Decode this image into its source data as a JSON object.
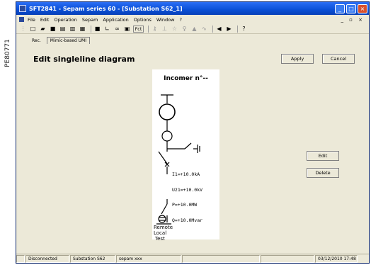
{
  "side_code": "PE80771",
  "window": {
    "title": "SFT2841 - Sepam series 60 - [Substation S62_1]",
    "controls": [
      "minimize-icon",
      "maximize-icon",
      "close-icon"
    ]
  },
  "menu": {
    "items": [
      "File",
      "Edit",
      "Operation",
      "Sepam",
      "Application",
      "Options",
      "Window",
      "?"
    ],
    "mdi_controls": "_ ▫ ×"
  },
  "toolbar": {
    "fct_label": "Fct",
    "icons": [
      "new-icon",
      "open-icon",
      "save-icon",
      "print-icon",
      "print-preview-icon",
      "print-all-icon",
      "sepam-save-icon",
      "chart-icon",
      "network-icon",
      "panel-icon",
      "fct-icon",
      "key-icon",
      "probe-icon",
      "connect-icon",
      "disconnect-icon",
      "alarm-icon",
      "wave-icon",
      "arrow-left-icon",
      "arrow-right-icon",
      "help-icon"
    ]
  },
  "tabs": [
    {
      "label": "Rec.",
      "active": false
    },
    {
      "label": "Mimic-based UMI",
      "active": true
    }
  ],
  "page": {
    "title": "Edit singleline diagram",
    "apply_label": "Apply",
    "cancel_label": "Cancel",
    "edit_label": "Edit",
    "delete_label": "Delete"
  },
  "diagram": {
    "title": "Incomer n°--",
    "measurements": [
      "I1=+10.0kA",
      "U21=+10.0kV",
      "P=+10.0MW",
      "Q=+10.0Mvar"
    ],
    "modes": [
      "Remote",
      "Local",
      "Test"
    ]
  },
  "status": {
    "cells": [
      "",
      "Disconnected",
      "Substation S62",
      "sepam xxx",
      "",
      "",
      "03/12/2010 17:48"
    ]
  }
}
